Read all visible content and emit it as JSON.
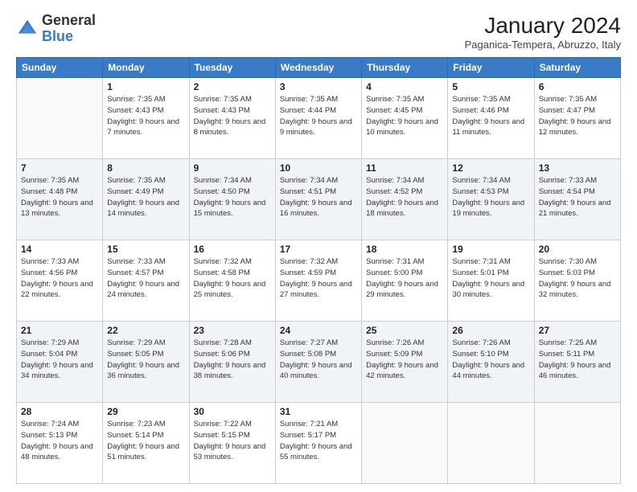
{
  "header": {
    "logo_general": "General",
    "logo_blue": "Blue",
    "title": "January 2024",
    "subtitle": "Paganica-Tempera, Abruzzo, Italy"
  },
  "calendar": {
    "days_of_week": [
      "Sunday",
      "Monday",
      "Tuesday",
      "Wednesday",
      "Thursday",
      "Friday",
      "Saturday"
    ],
    "weeks": [
      [
        {
          "day": "",
          "info": ""
        },
        {
          "day": "1",
          "info": "Sunrise: 7:35 AM\nSunset: 4:43 PM\nDaylight: 9 hours\nand 7 minutes."
        },
        {
          "day": "2",
          "info": "Sunrise: 7:35 AM\nSunset: 4:43 PM\nDaylight: 9 hours\nand 8 minutes."
        },
        {
          "day": "3",
          "info": "Sunrise: 7:35 AM\nSunset: 4:44 PM\nDaylight: 9 hours\nand 9 minutes."
        },
        {
          "day": "4",
          "info": "Sunrise: 7:35 AM\nSunset: 4:45 PM\nDaylight: 9 hours\nand 10 minutes."
        },
        {
          "day": "5",
          "info": "Sunrise: 7:35 AM\nSunset: 4:46 PM\nDaylight: 9 hours\nand 11 minutes."
        },
        {
          "day": "6",
          "info": "Sunrise: 7:35 AM\nSunset: 4:47 PM\nDaylight: 9 hours\nand 12 minutes."
        }
      ],
      [
        {
          "day": "7",
          "info": "Sunrise: 7:35 AM\nSunset: 4:48 PM\nDaylight: 9 hours\nand 13 minutes."
        },
        {
          "day": "8",
          "info": "Sunrise: 7:35 AM\nSunset: 4:49 PM\nDaylight: 9 hours\nand 14 minutes."
        },
        {
          "day": "9",
          "info": "Sunrise: 7:34 AM\nSunset: 4:50 PM\nDaylight: 9 hours\nand 15 minutes."
        },
        {
          "day": "10",
          "info": "Sunrise: 7:34 AM\nSunset: 4:51 PM\nDaylight: 9 hours\nand 16 minutes."
        },
        {
          "day": "11",
          "info": "Sunrise: 7:34 AM\nSunset: 4:52 PM\nDaylight: 9 hours\nand 18 minutes."
        },
        {
          "day": "12",
          "info": "Sunrise: 7:34 AM\nSunset: 4:53 PM\nDaylight: 9 hours\nand 19 minutes."
        },
        {
          "day": "13",
          "info": "Sunrise: 7:33 AM\nSunset: 4:54 PM\nDaylight: 9 hours\nand 21 minutes."
        }
      ],
      [
        {
          "day": "14",
          "info": "Sunrise: 7:33 AM\nSunset: 4:56 PM\nDaylight: 9 hours\nand 22 minutes."
        },
        {
          "day": "15",
          "info": "Sunrise: 7:33 AM\nSunset: 4:57 PM\nDaylight: 9 hours\nand 24 minutes."
        },
        {
          "day": "16",
          "info": "Sunrise: 7:32 AM\nSunset: 4:58 PM\nDaylight: 9 hours\nand 25 minutes."
        },
        {
          "day": "17",
          "info": "Sunrise: 7:32 AM\nSunset: 4:59 PM\nDaylight: 9 hours\nand 27 minutes."
        },
        {
          "day": "18",
          "info": "Sunrise: 7:31 AM\nSunset: 5:00 PM\nDaylight: 9 hours\nand 29 minutes."
        },
        {
          "day": "19",
          "info": "Sunrise: 7:31 AM\nSunset: 5:01 PM\nDaylight: 9 hours\nand 30 minutes."
        },
        {
          "day": "20",
          "info": "Sunrise: 7:30 AM\nSunset: 5:03 PM\nDaylight: 9 hours\nand 32 minutes."
        }
      ],
      [
        {
          "day": "21",
          "info": "Sunrise: 7:29 AM\nSunset: 5:04 PM\nDaylight: 9 hours\nand 34 minutes."
        },
        {
          "day": "22",
          "info": "Sunrise: 7:29 AM\nSunset: 5:05 PM\nDaylight: 9 hours\nand 36 minutes."
        },
        {
          "day": "23",
          "info": "Sunrise: 7:28 AM\nSunset: 5:06 PM\nDaylight: 9 hours\nand 38 minutes."
        },
        {
          "day": "24",
          "info": "Sunrise: 7:27 AM\nSunset: 5:08 PM\nDaylight: 9 hours\nand 40 minutes."
        },
        {
          "day": "25",
          "info": "Sunrise: 7:26 AM\nSunset: 5:09 PM\nDaylight: 9 hours\nand 42 minutes."
        },
        {
          "day": "26",
          "info": "Sunrise: 7:26 AM\nSunset: 5:10 PM\nDaylight: 9 hours\nand 44 minutes."
        },
        {
          "day": "27",
          "info": "Sunrise: 7:25 AM\nSunset: 5:11 PM\nDaylight: 9 hours\nand 46 minutes."
        }
      ],
      [
        {
          "day": "28",
          "info": "Sunrise: 7:24 AM\nSunset: 5:13 PM\nDaylight: 9 hours\nand 48 minutes."
        },
        {
          "day": "29",
          "info": "Sunrise: 7:23 AM\nSunset: 5:14 PM\nDaylight: 9 hours\nand 51 minutes."
        },
        {
          "day": "30",
          "info": "Sunrise: 7:22 AM\nSunset: 5:15 PM\nDaylight: 9 hours\nand 53 minutes."
        },
        {
          "day": "31",
          "info": "Sunrise: 7:21 AM\nSunset: 5:17 PM\nDaylight: 9 hours\nand 55 minutes."
        },
        {
          "day": "",
          "info": ""
        },
        {
          "day": "",
          "info": ""
        },
        {
          "day": "",
          "info": ""
        }
      ]
    ]
  }
}
